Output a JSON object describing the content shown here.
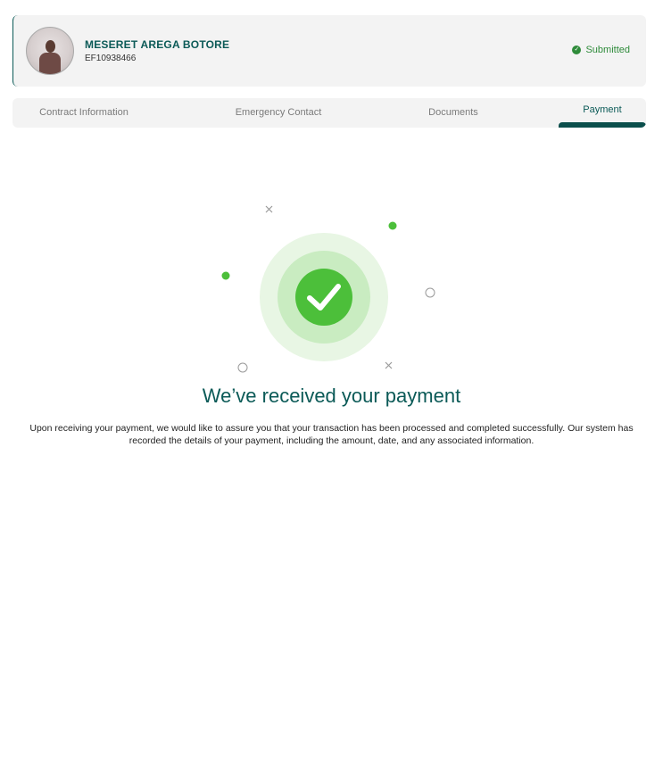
{
  "profile": {
    "name": "MESERET AREGA BOTORE",
    "employee_id": "EF10938466",
    "status_label": "Submitted",
    "status_icon": "check-circle-icon",
    "status_color": "#2e8b3a"
  },
  "tabs": [
    {
      "label": "Contract Information",
      "active": false
    },
    {
      "label": "Emergency Contact",
      "active": false
    },
    {
      "label": "Documents",
      "active": false
    },
    {
      "label": "Payment",
      "active": true
    }
  ],
  "confirmation": {
    "title": "We’ve received your payment",
    "description": "Upon receiving your payment, we would like to assure you that your transaction has been processed and completed successfully. Our system has recorded the details of your payment, including the amount, date, and any associated information.",
    "icon": "check-icon"
  },
  "colors": {
    "brand": "#0b5a57",
    "success": "#4cbf3a",
    "panel": "#f3f3f3"
  }
}
